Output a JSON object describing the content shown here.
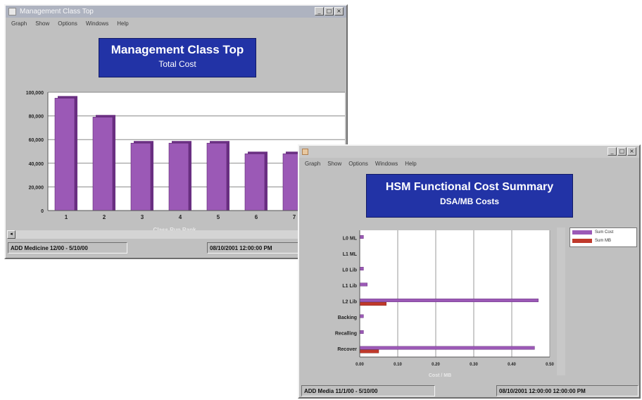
{
  "window1": {
    "title": "Management Class Top",
    "menu": [
      "Graph",
      "Show",
      "Options",
      "Windows",
      "Help"
    ],
    "chart_title_line1": "Management Class Top",
    "chart_title_line2": "Total Cost",
    "status_left": "ADD Medicine 12/00 - 5/10/00",
    "status_right": "08/10/2001 12:00:00 PM"
  },
  "window2": {
    "title": "",
    "menu": [
      "Graph",
      "Show",
      "Options",
      "Windows",
      "Help"
    ],
    "chart_title_line1": "HSM Functional Cost Summary",
    "chart_title_line2": "DSA/MB Costs",
    "status_left": "ADD Media 11/1/00 - 5/10/00",
    "status_right": "08/10/2001 12:00:00 12:00:00 PM",
    "legend": [
      {
        "label": "Sum Cost",
        "color": "#9b59b6"
      },
      {
        "label": "Sum MB",
        "color": "#c0392b"
      }
    ]
  },
  "colors": {
    "bar": "#9b59b6",
    "bar_dark": "#6a2f82",
    "bar2": "#c0392b",
    "title_bg": "#2233a6"
  },
  "chart_data": [
    {
      "type": "bar",
      "title": "Management Class Top",
      "subtitle": "Total Cost",
      "categories": [
        "1",
        "2",
        "3",
        "4",
        "5",
        "6",
        "7"
      ],
      "values": [
        95000,
        79000,
        57000,
        57000,
        57000,
        48000,
        48000
      ],
      "ylim": [
        0,
        100000
      ],
      "yticks": [
        "0",
        "20,000",
        "40,000",
        "60,000",
        "80,000",
        "100,000"
      ],
      "xlabel": "Class Run Rank",
      "grid": true
    },
    {
      "type": "bar",
      "orientation": "horizontal",
      "title": "HSM Functional Cost Summary",
      "subtitle": "DSA/MB Costs",
      "categories": [
        "Recover",
        "Recalling",
        "Backing",
        "L2 Lib",
        "L1 Lib",
        "L0 Lib",
        "L1 ML",
        "L0 ML"
      ],
      "series": [
        {
          "name": "Sum Cost",
          "values": [
            0.46,
            0.01,
            0.01,
            0.47,
            0.02,
            0.01,
            0.0,
            0.01
          ]
        },
        {
          "name": "Sum MB",
          "values": [
            0.05,
            0.0,
            0.0,
            0.07,
            0.0,
            0.0,
            0.0,
            0.0
          ]
        }
      ],
      "xlim": [
        0,
        0.5
      ],
      "xticks": [
        "0.00",
        "0.10",
        "0.20",
        "0.30",
        "0.40",
        "0.50"
      ],
      "xlabel": "Cost / MB",
      "grid": true,
      "legend": "right"
    }
  ]
}
